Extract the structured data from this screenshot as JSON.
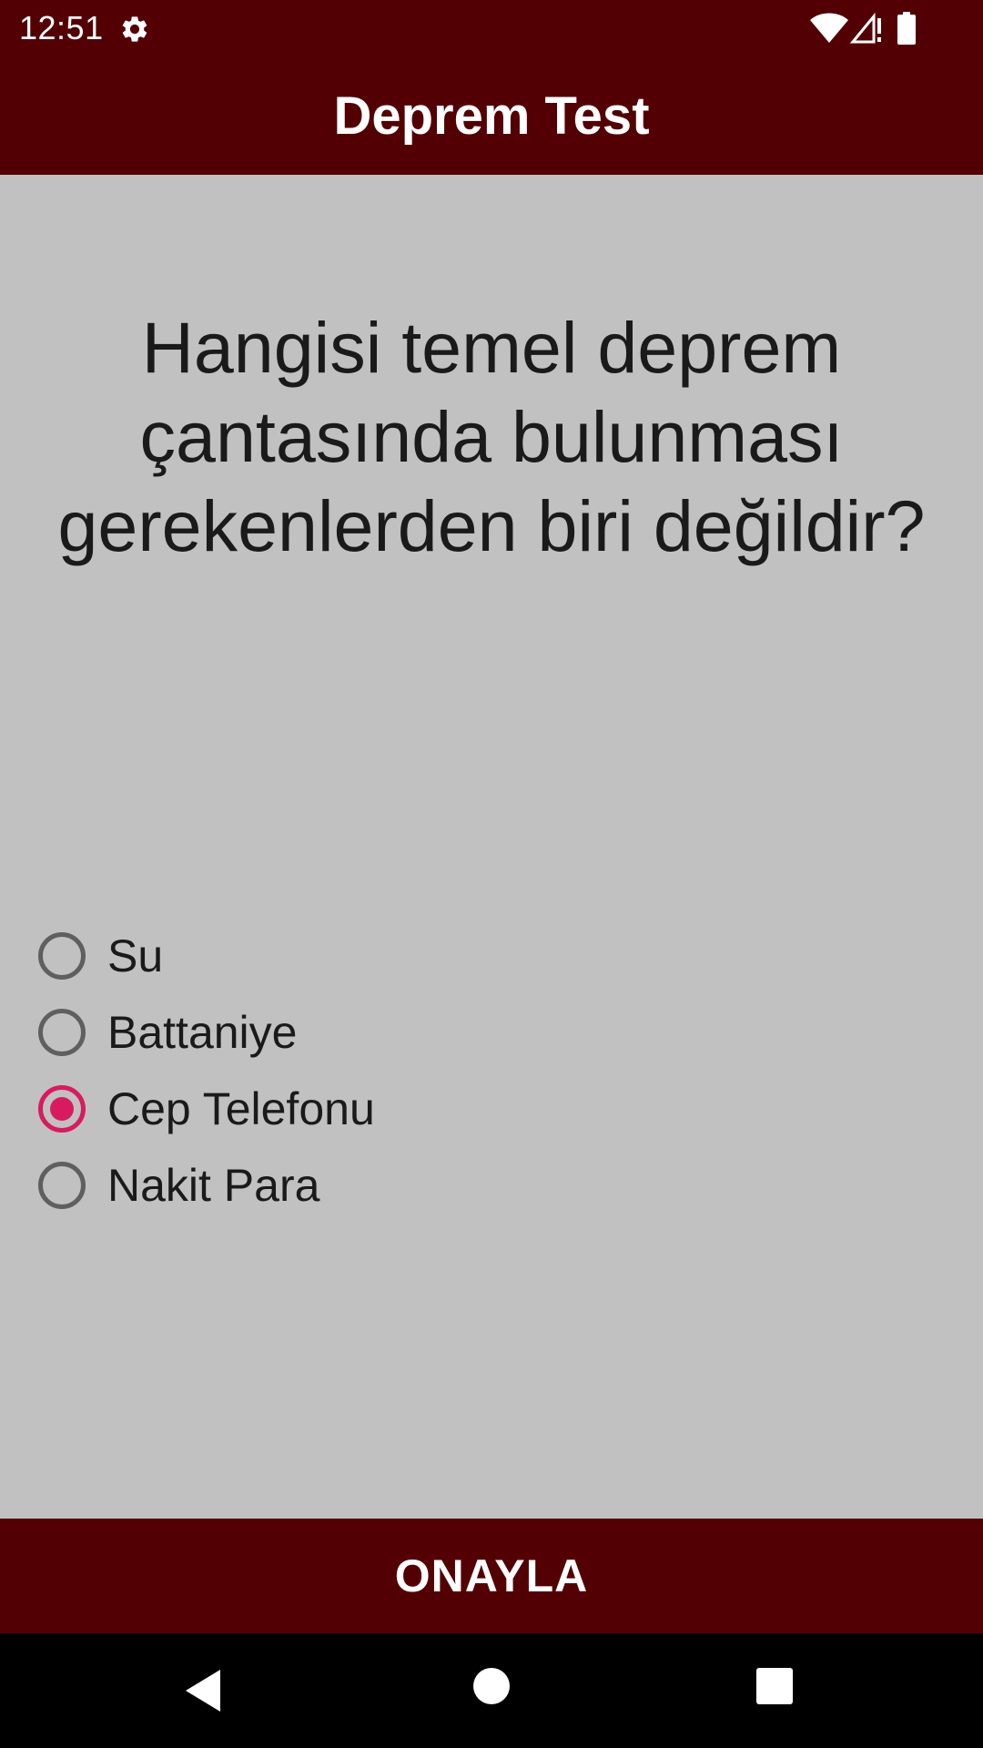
{
  "status_bar": {
    "time": "12:51",
    "icons": [
      "gear-icon",
      "wifi-icon",
      "cell-signal-icon",
      "battery-icon"
    ]
  },
  "app_bar": {
    "title": "Deprem Test"
  },
  "quiz": {
    "question": "Hangisi temel deprem çantasında bulunması gerekenlerden biri değildir?",
    "options": [
      {
        "label": "Su",
        "selected": false
      },
      {
        "label": "Battaniye",
        "selected": false
      },
      {
        "label": "Cep Telefonu",
        "selected": true
      },
      {
        "label": "Nakit Para",
        "selected": false
      }
    ],
    "confirm_label": "ONAYLA"
  },
  "nav_bar": {
    "icons": [
      "back-icon",
      "home-icon",
      "recents-icon"
    ]
  },
  "colors": {
    "bar_background": "#530005",
    "content_background": "#c1c1c1",
    "radio_accent": "#d81b60",
    "radio_unchecked": "#5f5f5f"
  }
}
